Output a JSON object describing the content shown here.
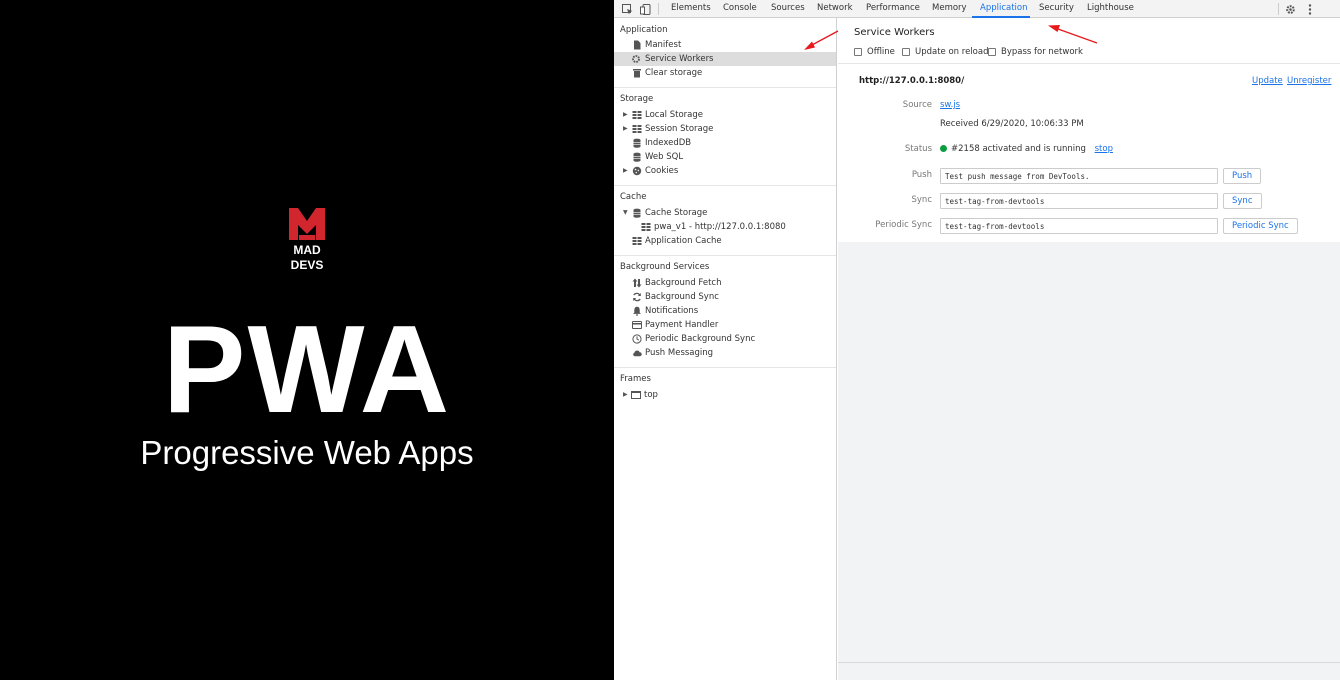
{
  "hero": {
    "logo_text_line1": "MAD",
    "logo_text_line2": "DEVS",
    "title": "PWA",
    "subtitle": "Progressive Web Apps"
  },
  "toolbar": {
    "tabs": [
      "Elements",
      "Console",
      "Sources",
      "Network",
      "Performance",
      "Memory",
      "Application",
      "Security",
      "Lighthouse"
    ],
    "active_tab": "Application",
    "icons": [
      "inspect-icon",
      "device-toggle-icon",
      "gear-icon",
      "kebab-menu-icon"
    ]
  },
  "sidebar": {
    "application": {
      "title": "Application",
      "items": [
        {
          "label": "Manifest",
          "icon": "file-icon"
        },
        {
          "label": "Service Workers",
          "icon": "gear-icon",
          "selected": true
        },
        {
          "label": "Clear storage",
          "icon": "trash-icon"
        }
      ]
    },
    "storage": {
      "title": "Storage",
      "items": [
        {
          "label": "Local Storage",
          "icon": "grid-icon",
          "expandable": true
        },
        {
          "label": "Session Storage",
          "icon": "grid-icon",
          "expandable": true
        },
        {
          "label": "IndexedDB",
          "icon": "database-icon"
        },
        {
          "label": "Web SQL",
          "icon": "database-icon"
        },
        {
          "label": "Cookies",
          "icon": "cookie-icon",
          "expandable": true
        }
      ]
    },
    "cache": {
      "title": "Cache",
      "items": [
        {
          "label": "Cache Storage",
          "icon": "database-icon",
          "expanded": true
        },
        {
          "label": "pwa_v1 - http://127.0.0.1:8080",
          "icon": "grid-icon",
          "child": true
        },
        {
          "label": "Application Cache",
          "icon": "grid-icon"
        }
      ]
    },
    "background": {
      "title": "Background Services",
      "items": [
        {
          "label": "Background Fetch",
          "icon": "up-down-arrows-icon"
        },
        {
          "label": "Background Sync",
          "icon": "sync-icon"
        },
        {
          "label": "Notifications",
          "icon": "bell-icon"
        },
        {
          "label": "Payment Handler",
          "icon": "credit-card-icon"
        },
        {
          "label": "Periodic Background Sync",
          "icon": "clock-icon"
        },
        {
          "label": "Push Messaging",
          "icon": "cloud-icon"
        }
      ]
    },
    "frames": {
      "title": "Frames",
      "items": [
        {
          "label": "top",
          "icon": "frame-icon",
          "expandable": true
        }
      ]
    }
  },
  "main": {
    "heading": "Service Workers",
    "options": [
      "Offline",
      "Update on reload",
      "Bypass for network"
    ],
    "origin": "http://127.0.0.1:8080/",
    "update_link": "Update",
    "unregister_link": "Unregister",
    "source_label": "Source",
    "source_value": "sw.js",
    "received": "Received 6/29/2020, 10:06:33 PM",
    "status_label": "Status",
    "status_value": "#2158 activated and is running",
    "status_color": "#0a9e3f",
    "stop_link": "stop",
    "push_label": "Push",
    "push_value": "Test push message from DevTools.",
    "push_button": "Push",
    "sync_label": "Sync",
    "sync_value": "test-tag-from-devtools",
    "sync_button": "Sync",
    "periodic_label": "Periodic Sync",
    "periodic_value": "test-tag-from-devtools",
    "periodic_button": "Periodic Sync"
  },
  "colors": {
    "accent": "#1a73e8",
    "logo_red": "#d1262e",
    "annotation_red": "#e8191b"
  }
}
